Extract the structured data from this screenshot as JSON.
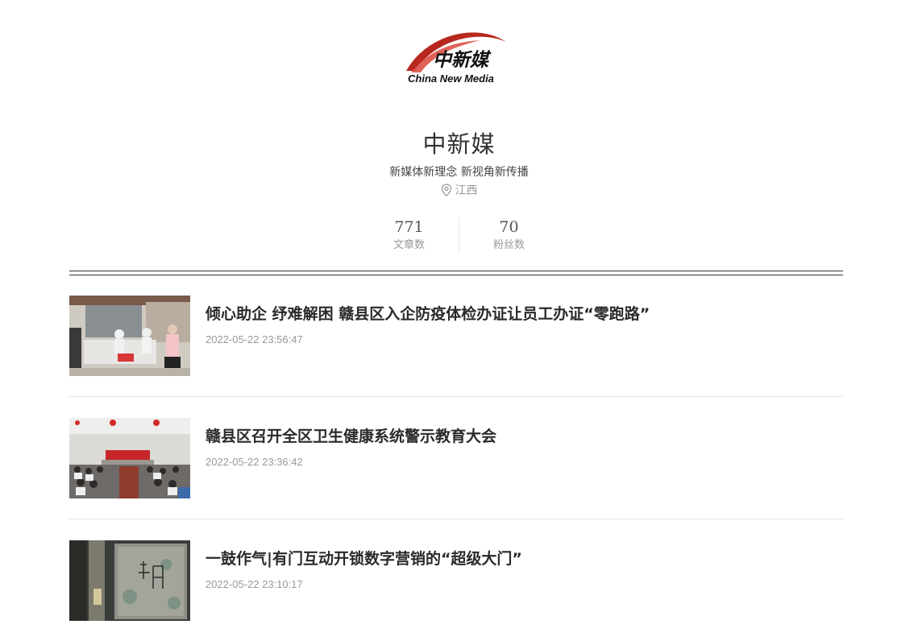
{
  "logo": {
    "brand_cn": "中新媒",
    "brand_en": "China New Media",
    "brand_color": "#b8281e"
  },
  "profile": {
    "name": "中新媒",
    "slogan": "新媒体新理念 新视角新传播",
    "location_icon": "map-pin-icon",
    "location": "江西"
  },
  "stats": [
    {
      "value": "771",
      "label": "文章数"
    },
    {
      "value": "70",
      "label": "粉丝数"
    }
  ],
  "articles": [
    {
      "title": "倾心助企 纾难解困 赣县区入企防疫体检办证让员工办证“零跑路”",
      "time": "2022-05-22 23:56:47"
    },
    {
      "title": "赣县区召开全区卫生健康系统警示教育大会",
      "time": "2022-05-22 23:36:42"
    },
    {
      "title": "一鼓作气|有门互动开锁数字营销的“超级大门”",
      "time": "2022-05-22 23:10:17"
    }
  ]
}
